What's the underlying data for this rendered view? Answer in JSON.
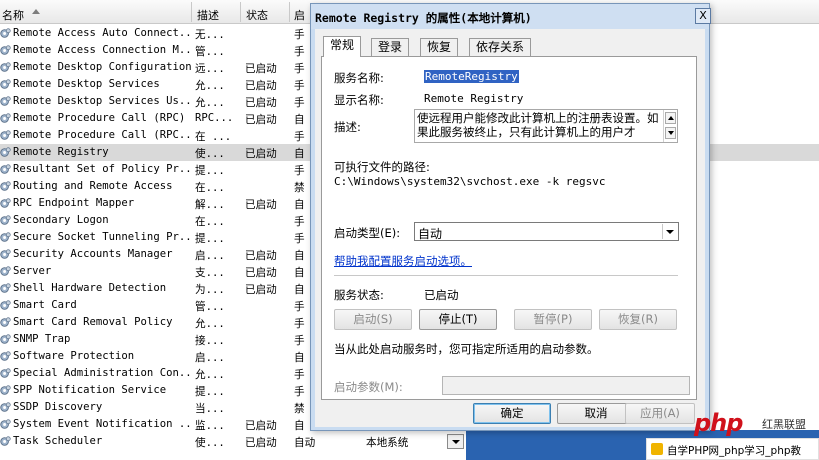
{
  "services_list": {
    "columns": {
      "name": "名称",
      "desc": "描述",
      "status": "状态",
      "startup": "启"
    },
    "rows": [
      {
        "name": "Remote Access Auto Connect...",
        "desc": "无...",
        "status": "",
        "startup": "手",
        "logon": ""
      },
      {
        "name": "Remote Access Connection M...",
        "desc": "管...",
        "status": "",
        "startup": "手",
        "logon": ""
      },
      {
        "name": "Remote Desktop Configuration",
        "desc": "远...",
        "status": "已启动",
        "startup": "手",
        "logon": ""
      },
      {
        "name": "Remote Desktop Services",
        "desc": "允...",
        "status": "已启动",
        "startup": "手",
        "logon": ""
      },
      {
        "name": "Remote Desktop Services Us...",
        "desc": "允...",
        "status": "已启动",
        "startup": "手",
        "logon": ""
      },
      {
        "name": "Remote Procedure Call (RPC)",
        "desc": "RPC...",
        "status": "已启动",
        "startup": "自",
        "logon": ""
      },
      {
        "name": "Remote Procedure Call (RPC...",
        "desc": "在 ...",
        "status": "",
        "startup": "手",
        "logon": ""
      },
      {
        "name": "Remote Registry",
        "desc": "使...",
        "status": "已启动",
        "startup": "自",
        "logon": ""
      },
      {
        "name": "Resultant Set of Policy Pr...",
        "desc": "提...",
        "status": "",
        "startup": "手",
        "logon": ""
      },
      {
        "name": "Routing and Remote Access",
        "desc": "在...",
        "status": "",
        "startup": "禁",
        "logon": ""
      },
      {
        "name": "RPC Endpoint Mapper",
        "desc": "解...",
        "status": "已启动",
        "startup": "自",
        "logon": ""
      },
      {
        "name": "Secondary Logon",
        "desc": "在...",
        "status": "",
        "startup": "手",
        "logon": ""
      },
      {
        "name": "Secure Socket Tunneling Pr...",
        "desc": "提...",
        "status": "",
        "startup": "手",
        "logon": ""
      },
      {
        "name": "Security Accounts Manager",
        "desc": "启...",
        "status": "已启动",
        "startup": "自",
        "logon": ""
      },
      {
        "name": "Server",
        "desc": "支...",
        "status": "已启动",
        "startup": "自",
        "logon": ""
      },
      {
        "name": "Shell Hardware Detection",
        "desc": "为...",
        "status": "已启动",
        "startup": "自",
        "logon": ""
      },
      {
        "name": "Smart Card",
        "desc": "管...",
        "status": "",
        "startup": "手",
        "logon": ""
      },
      {
        "name": "Smart Card Removal Policy",
        "desc": "允...",
        "status": "",
        "startup": "手",
        "logon": ""
      },
      {
        "name": "SNMP Trap",
        "desc": "接...",
        "status": "",
        "startup": "手",
        "logon": ""
      },
      {
        "name": "Software Protection",
        "desc": "启...",
        "status": "",
        "startup": "自",
        "logon": ""
      },
      {
        "name": "Special Administration Con...",
        "desc": "允...",
        "status": "",
        "startup": "手",
        "logon": ""
      },
      {
        "name": "SPP Notification Service",
        "desc": "提...",
        "status": "",
        "startup": "手",
        "logon": ""
      },
      {
        "name": "SSDP Discovery",
        "desc": "当...",
        "status": "",
        "startup": "禁",
        "logon": ""
      },
      {
        "name": "System Event Notification ...",
        "desc": "监...",
        "status": "已启动",
        "startup": "自",
        "logon": ""
      },
      {
        "name": "Task Scheduler",
        "desc": "使...",
        "status": "已启动",
        "startup": "自动",
        "logon": "本地系统"
      }
    ],
    "selected_row": "Remote Registry"
  },
  "dialog": {
    "title": "Remote Registry 的属性(本地计算机)",
    "close_glyph": "X",
    "tabs": [
      "常规",
      "登录",
      "恢复",
      "依存关系"
    ],
    "active_tab": "常规",
    "service_name_label": "服务名称:",
    "service_name_value": "RemoteRegistry",
    "display_name_label": "显示名称:",
    "display_name_value": "Remote Registry",
    "description_label": "描述:",
    "description_text": "使远程用户能修改此计算机上的注册表设置。如果此服务被终止，只有此计算机上的用户才",
    "exe_path_label": "可执行文件的路径:",
    "exe_path_value": "C:\\Windows\\system32\\svchost.exe -k regsvc",
    "startup_type_label": "启动类型(E):",
    "startup_type_value": "自动",
    "help_link": "帮助我配置服务启动选项。",
    "service_status_label": "服务状态:",
    "service_status_value": "已启动",
    "btn_start": "启动(S)",
    "btn_stop": "停止(T)",
    "btn_pause": "暂停(P)",
    "btn_resume": "恢复(R)",
    "hint_text": "当从此处启动服务时，您可指定所适用的启动参数。",
    "start_params_label": "启动参数(M):",
    "start_params_value": "",
    "btn_ok": "确定",
    "btn_cancel": "取消",
    "btn_apply": "应用(A)"
  },
  "watermark": {
    "logo_text": "php",
    "brand_text": "红黑联盟",
    "caption": "自学PHP网_php学习_php教"
  },
  "colors": {
    "accent_blue": "#3063c3",
    "link_blue": "#0033cc",
    "dialog_frame": "#c9dcf1",
    "watermark_red": "#d0111b"
  }
}
